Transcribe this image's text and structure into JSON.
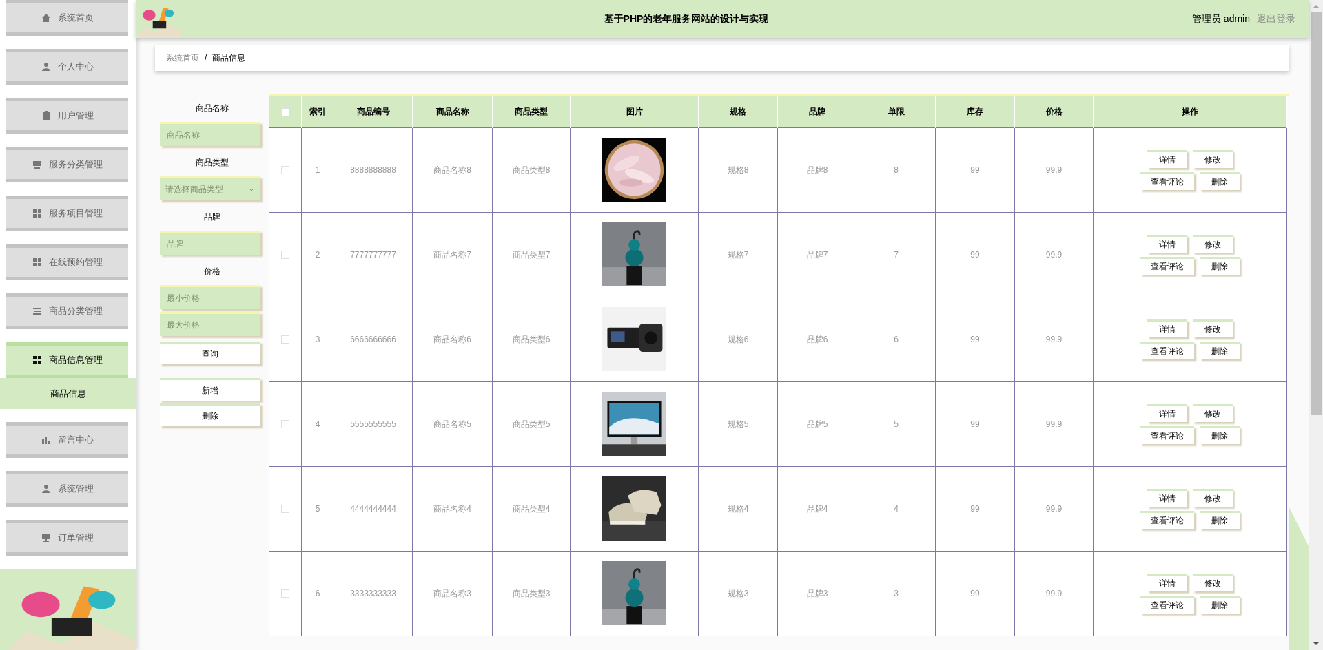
{
  "sidebar": {
    "items": [
      {
        "label": "系统首页",
        "selected": false
      },
      {
        "label": "个人中心",
        "selected": false
      },
      {
        "label": "用户管理",
        "selected": false
      },
      {
        "label": "服务分类管理",
        "selected": false
      },
      {
        "label": "服务项目管理",
        "selected": false
      },
      {
        "label": "在线预约管理",
        "selected": false
      },
      {
        "label": "商品分类管理",
        "selected": false
      },
      {
        "label": "商品信息管理",
        "selected": true,
        "expanded": true,
        "children": [
          {
            "label": "商品信息",
            "selected": true
          }
        ]
      },
      {
        "label": "留言中心",
        "selected": false
      },
      {
        "label": "系统管理",
        "selected": false
      },
      {
        "label": "订单管理",
        "selected": false
      }
    ]
  },
  "header": {
    "title": "基于PHP的老年服务网站的设计与实现",
    "user": "管理员 admin",
    "logout": "退出登录"
  },
  "breadcrumb": {
    "home": "系统首页",
    "separator": "/",
    "current": "商品信息"
  },
  "filters": [
    {
      "kind": "input",
      "label": "商品名称",
      "placeholder": "商品名称"
    },
    {
      "kind": "select",
      "label": "商品类型",
      "placeholder": "请选择商品类型"
    },
    {
      "kind": "input",
      "label": "品牌",
      "placeholder": "品牌"
    },
    {
      "kind": "input",
      "label": "价格",
      "placeholder": "最小价格"
    },
    {
      "kind": "input",
      "placeholder": "最大价格"
    }
  ],
  "filter_buttons": [
    "查询",
    "新增",
    "删除"
  ],
  "table": {
    "header_checked": false,
    "columns": [
      "索引",
      "商品编号",
      "商品名称",
      "商品类型",
      "图片",
      "规格",
      "品牌",
      "单限",
      "库存",
      "价格",
      "操作"
    ],
    "rows": [
      {
        "checked": false,
        "cells": [
          "1",
          "8888888888",
          "商品名称8",
          "商品类型8",
          {
            "kind": "picture"
          },
          "规格8",
          "品牌8",
          "8",
          "99",
          "99.9"
        ],
        "actions": [
          "详情",
          "修改",
          "查看评论",
          "删除"
        ]
      },
      {
        "checked": false,
        "cells": [
          "2",
          "7777777777",
          "商品名称7",
          "商品类型7",
          {
            "kind": "picture"
          },
          "规格7",
          "品牌7",
          "7",
          "99",
          "99.9"
        ],
        "actions": [
          "详情",
          "修改",
          "查看评论",
          "删除"
        ]
      },
      {
        "checked": false,
        "cells": [
          "3",
          "6666666666",
          "商品名称6",
          "商品类型6",
          {
            "kind": "picture"
          },
          "规格6",
          "品牌6",
          "6",
          "99",
          "99.9"
        ],
        "actions": [
          "详情",
          "修改",
          "查看评论",
          "删除"
        ]
      },
      {
        "checked": false,
        "cells": [
          "4",
          "5555555555",
          "商品名称5",
          "商品类型5",
          {
            "kind": "picture"
          },
          "规格5",
          "品牌5",
          "5",
          "99",
          "99.9"
        ],
        "actions": [
          "详情",
          "修改",
          "查看评论",
          "删除"
        ]
      },
      {
        "checked": false,
        "cells": [
          "5",
          "4444444444",
          "商品名称4",
          "商品类型4",
          {
            "kind": "picture"
          },
          "规格4",
          "品牌4",
          "4",
          "99",
          "99.9"
        ],
        "actions": [
          "详情",
          "修改",
          "查看评论",
          "删除"
        ]
      },
      {
        "checked": false,
        "cells": [
          "6",
          "3333333333",
          "商品名称3",
          "商品类型3",
          {
            "kind": "picture"
          },
          "规格3",
          "品牌3",
          "3",
          "99",
          "99.9"
        ],
        "actions": [
          "详情",
          "修改",
          "查看评论",
          "删除"
        ]
      }
    ]
  }
}
